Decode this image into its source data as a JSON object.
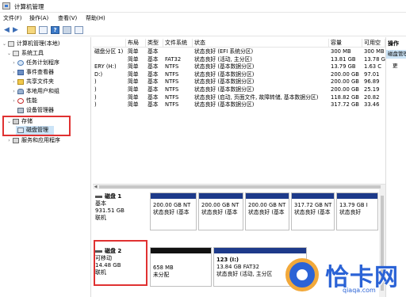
{
  "window": {
    "title": "计算机管理"
  },
  "menu": [
    "文件(F)",
    "操作(A)",
    "查看(V)",
    "帮助(H)"
  ],
  "tree": {
    "root": "计算机管理(本地)",
    "system_tools": "系统工具",
    "items": [
      "任务计划程序",
      "事件查看器",
      "共享文件夹",
      "本地用户和组",
      "性能",
      "设备管理器"
    ],
    "storage": "存储",
    "disk_mgmt": "磁盘管理",
    "services": "服务和应用程序"
  },
  "table": {
    "headers": [
      "",
      "布局",
      "类型",
      "文件系统",
      "状态",
      "容量",
      "可用空"
    ],
    "rows": [
      [
        "磁盘分区 1)",
        "简单",
        "基本",
        "",
        "状态良好 (EFI 系统分区)",
        "300 MB",
        "300 MB"
      ],
      [
        "",
        "简单",
        "基本",
        "FAT32",
        "状态良好 (活动, 主分区)",
        "13.81 GB",
        "13.78 G"
      ],
      [
        "ERY (H:)",
        "简单",
        "基本",
        "NTFS",
        "状态良好 (基本数据分区)",
        "13.79 GB",
        "1.63 C"
      ],
      [
        "D:)",
        "简单",
        "基本",
        "NTFS",
        "状态良好 (基本数据分区)",
        "200.00 GB",
        "97.01"
      ],
      [
        ")",
        "简单",
        "基本",
        "NTFS",
        "状态良好 (基本数据分区)",
        "200.00 GB",
        "96.89"
      ],
      [
        ")",
        "简单",
        "基本",
        "NTFS",
        "状态良好 (基本数据分区)",
        "200.00 GB",
        "25.19"
      ],
      [
        ")",
        "简单",
        "基本",
        "NTFS",
        "状态良好 (启动, 页面文件, 故障转储, 基本数据分区)",
        "118.82 GB",
        "20.82"
      ],
      [
        ")",
        "简单",
        "基本",
        "NTFS",
        "状态良好 (基本数据分区)",
        "317.72 GB",
        "33.46"
      ]
    ]
  },
  "disk1": {
    "name": "磁盘 1",
    "type": "基本",
    "size": "931.51 GB",
    "status": "联机",
    "parts": [
      {
        "l1": "",
        "l2": "200.00 GB NT",
        "l3": "状态良好 (基本"
      },
      {
        "l1": "",
        "l2": "200.00 GB NT",
        "l3": "状态良好 (基本"
      },
      {
        "l1": "",
        "l2": "200.00 GB NT",
        "l3": "状态良好 (基本"
      },
      {
        "l1": "",
        "l2": "317.72 GB NT",
        "l3": "状态良好 (基本"
      },
      {
        "l1": "",
        "l2": "13.79 GB I",
        "l3": "状态良好"
      }
    ]
  },
  "disk2": {
    "name": "磁盘 2",
    "type": "可移动",
    "size": "14.48 GB",
    "status": "联机",
    "unalloc_size": "658 MB",
    "unalloc_label": "未分配",
    "vol_name": "123  (I:)",
    "vol_size": "13.84 GB FAT32",
    "vol_status": "状态良好 (活动, 主分区"
  },
  "actions": {
    "header": "操作",
    "selected": "磁盘管理",
    "more": "更"
  },
  "watermark": {
    "cn": "恰卡网",
    "en": "qiaqa.com"
  },
  "colors": {
    "partition_bar": "#1d3a8a",
    "unallocated_bar": "#111111",
    "highlight_frame": "#e03131",
    "selection": "#cce4f7"
  }
}
